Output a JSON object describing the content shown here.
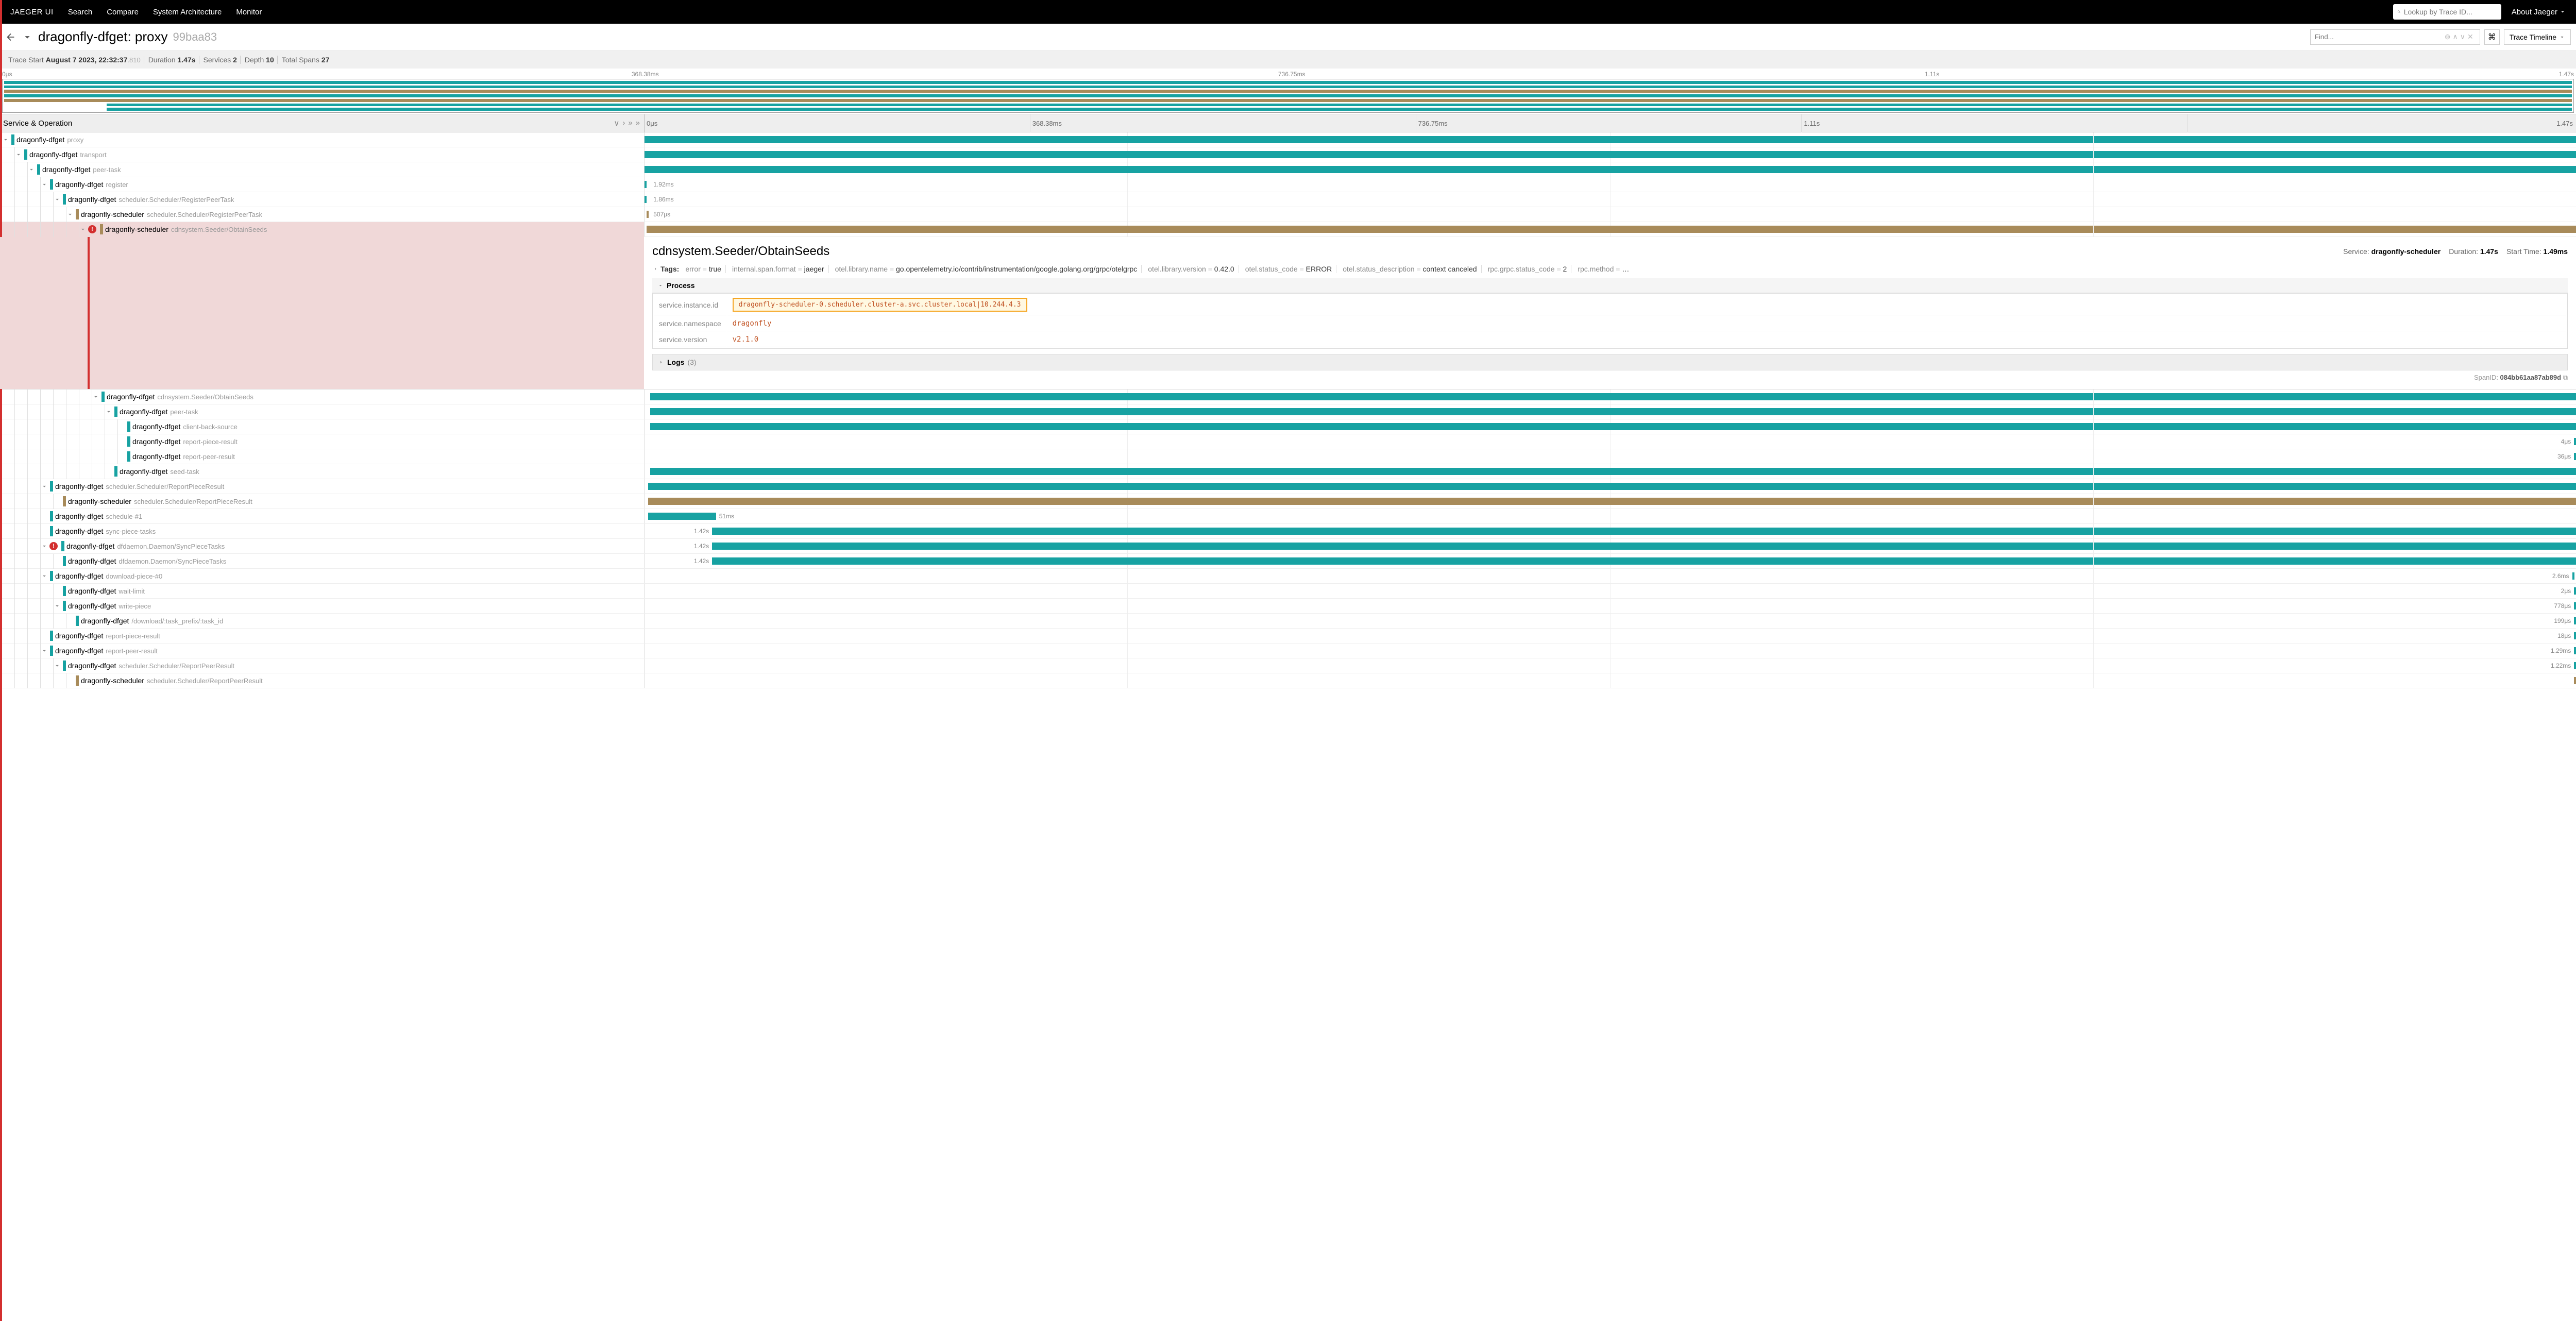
{
  "topbar": {
    "brand": "JAEGER UI",
    "links": [
      "Search",
      "Compare",
      "System Architecture",
      "Monitor"
    ],
    "lookup_placeholder": "Lookup by Trace ID...",
    "about": "About Jaeger"
  },
  "trace": {
    "title_service": "dragonfly-dfget:",
    "title_op": "proxy",
    "trace_id": "99baa83",
    "find_placeholder": "Find...",
    "timeline_btn": "Trace Timeline"
  },
  "meta": {
    "start_label": "Trace Start",
    "start": "August 7 2023, 22:32:37",
    "start_ms": ".810",
    "duration_label": "Duration",
    "duration": "1.47s",
    "services_label": "Services",
    "services": "2",
    "depth_label": "Depth",
    "depth": "10",
    "spans_label": "Total Spans",
    "spans": "27"
  },
  "ticks": [
    "0μs",
    "368.38ms",
    "736.75ms",
    "1.11s",
    "1.47s"
  ],
  "columns_header": "Service & Operation",
  "spans": [
    {
      "depth": 0,
      "chev": true,
      "color": "teal",
      "svc": "dragonfly-dfget",
      "op": "proxy",
      "left": 0,
      "width": 100,
      "err": false
    },
    {
      "depth": 1,
      "chev": true,
      "color": "teal",
      "svc": "dragonfly-dfget",
      "op": "transport",
      "left": 0,
      "width": 100,
      "err": false
    },
    {
      "depth": 2,
      "chev": true,
      "color": "teal",
      "svc": "dragonfly-dfget",
      "op": "peer-task",
      "left": 0,
      "width": 100,
      "err": false
    },
    {
      "depth": 3,
      "chev": true,
      "color": "teal",
      "svc": "dragonfly-dfget",
      "op": "register",
      "left": 0,
      "width": 0.3,
      "dur": "1.92ms",
      "labelpos": "right",
      "err": false
    },
    {
      "depth": 4,
      "chev": true,
      "color": "teal",
      "svc": "dragonfly-dfget",
      "op": "scheduler.Scheduler/RegisterPeerTask",
      "left": 0,
      "width": 0.3,
      "dur": "1.86ms",
      "labelpos": "right",
      "err": false
    },
    {
      "depth": 5,
      "chev": true,
      "color": "brown",
      "svc": "dragonfly-scheduler",
      "op": "scheduler.Scheduler/RegisterPeerTask",
      "left": 0.1,
      "width": 0.2,
      "dur": "507μs",
      "labelpos": "right",
      "err": false
    },
    {
      "depth": 6,
      "chev": true,
      "color": "brown",
      "svc": "dragonfly-scheduler",
      "op": "cdnsystem.Seeder/ObtainSeeds",
      "left": 0.1,
      "width": 99.9,
      "err": true,
      "selected": true,
      "detail": true
    },
    {
      "depth": 7,
      "chev": true,
      "color": "teal",
      "svc": "dragonfly-dfget",
      "op": "cdnsystem.Seeder/ObtainSeeds",
      "left": 0.3,
      "width": 99.7,
      "err": false
    },
    {
      "depth": 8,
      "chev": true,
      "color": "teal",
      "svc": "dragonfly-dfget",
      "op": "peer-task",
      "left": 0.3,
      "width": 99.7,
      "err": false
    },
    {
      "depth": 9,
      "chev": false,
      "color": "teal",
      "svc": "dragonfly-dfget",
      "op": "client-back-source",
      "left": 0.3,
      "width": 99.7,
      "err": false
    },
    {
      "depth": 9,
      "chev": false,
      "color": "teal",
      "svc": "dragonfly-dfget",
      "op": "report-piece-result",
      "left": 99.9,
      "width": 0.1,
      "dur": "4μs",
      "labelpos": "left",
      "err": false
    },
    {
      "depth": 9,
      "chev": false,
      "color": "teal",
      "svc": "dragonfly-dfget",
      "op": "report-peer-result",
      "left": 99.9,
      "width": 0.1,
      "dur": "36μs",
      "labelpos": "left",
      "err": false
    },
    {
      "depth": 8,
      "chev": false,
      "color": "teal",
      "svc": "dragonfly-dfget",
      "op": "seed-task",
      "left": 0.3,
      "width": 99.7,
      "err": false
    },
    {
      "depth": 3,
      "chev": true,
      "color": "teal",
      "svc": "dragonfly-dfget",
      "op": "scheduler.Scheduler/ReportPieceResult",
      "left": 0.2,
      "width": 99.8,
      "err": false
    },
    {
      "depth": 4,
      "chev": false,
      "color": "brown",
      "svc": "dragonfly-scheduler",
      "op": "scheduler.Scheduler/ReportPieceResult",
      "left": 0.2,
      "width": 99.8,
      "err": false
    },
    {
      "depth": 3,
      "chev": false,
      "color": "teal",
      "svc": "dragonfly-dfget",
      "op": "schedule-#1",
      "left": 0.2,
      "width": 3.5,
      "dur": "51ms",
      "labelpos": "right",
      "err": false
    },
    {
      "depth": 3,
      "chev": false,
      "color": "teal",
      "svc": "dragonfly-dfget",
      "op": "sync-piece-tasks",
      "left": 3.5,
      "width": 96.5,
      "dur": "1.42s",
      "labelpos": "leftin",
      "err": false
    },
    {
      "depth": 3,
      "chev": true,
      "color": "teal",
      "svc": "dragonfly-dfget",
      "op": "dfdaemon.Daemon/SyncPieceTasks",
      "left": 3.5,
      "width": 96.5,
      "dur": "1.42s",
      "labelpos": "leftin",
      "err": true
    },
    {
      "depth": 4,
      "chev": false,
      "color": "teal",
      "svc": "dragonfly-dfget",
      "op": "dfdaemon.Daemon/SyncPieceTasks",
      "left": 3.5,
      "width": 96.5,
      "dur": "1.42s",
      "labelpos": "leftin",
      "err": false
    },
    {
      "depth": 3,
      "chev": true,
      "color": "teal",
      "svc": "dragonfly-dfget",
      "op": "download-piece-#0",
      "left": 99.8,
      "width": 0.2,
      "dur": "2.6ms",
      "labelpos": "left",
      "err": false
    },
    {
      "depth": 4,
      "chev": false,
      "color": "teal",
      "svc": "dragonfly-dfget",
      "op": "wait-limit",
      "left": 99.9,
      "width": 0.1,
      "dur": "2μs",
      "labelpos": "left",
      "err": false
    },
    {
      "depth": 4,
      "chev": true,
      "color": "teal",
      "svc": "dragonfly-dfget",
      "op": "write-piece",
      "left": 99.9,
      "width": 0.1,
      "dur": "778μs",
      "labelpos": "left",
      "err": false
    },
    {
      "depth": 5,
      "chev": false,
      "color": "teal",
      "svc": "dragonfly-dfget",
      "op": "/download/:task_prefix/:task_id",
      "left": 99.9,
      "width": 0.1,
      "dur": "199μs",
      "labelpos": "left",
      "err": false
    },
    {
      "depth": 3,
      "chev": false,
      "color": "teal",
      "svc": "dragonfly-dfget",
      "op": "report-piece-result",
      "left": 99.9,
      "width": 0.1,
      "dur": "18μs",
      "labelpos": "left",
      "err": false
    },
    {
      "depth": 3,
      "chev": true,
      "color": "teal",
      "svc": "dragonfly-dfget",
      "op": "report-peer-result",
      "left": 99.9,
      "width": 0.1,
      "dur": "1.29ms",
      "labelpos": "left",
      "err": false
    },
    {
      "depth": 4,
      "chev": true,
      "color": "teal",
      "svc": "dragonfly-dfget",
      "op": "scheduler.Scheduler/ReportPeerResult",
      "left": 99.9,
      "width": 0.1,
      "dur": "1.22ms",
      "labelpos": "left",
      "err": false
    },
    {
      "depth": 5,
      "chev": false,
      "color": "brown",
      "svc": "dragonfly-scheduler",
      "op": "scheduler.Scheduler/ReportPeerResult",
      "left": 99.9,
      "width": 0.1,
      "err": false
    }
  ],
  "detail": {
    "title": "cdnsystem.Seeder/ObtainSeeds",
    "service_label": "Service:",
    "service": "dragonfly-scheduler",
    "duration_label": "Duration:",
    "duration": "1.47s",
    "start_label": "Start Time:",
    "start": "1.49ms",
    "tags_label": "Tags:",
    "tags": [
      {
        "k": "error",
        "v": "true"
      },
      {
        "k": "internal.span.format",
        "v": "jaeger"
      },
      {
        "k": "otel.library.name",
        "v": "go.opentelemetry.io/contrib/instrumentation/google.golang.org/grpc/otelgrpc"
      },
      {
        "k": "otel.library.version",
        "v": "0.42.0"
      },
      {
        "k": "otel.status_code",
        "v": "ERROR"
      },
      {
        "k": "otel.status_description",
        "v": "context canceled"
      },
      {
        "k": "rpc.grpc.status_code",
        "v": "2"
      },
      {
        "k": "rpc.method",
        "v": "…"
      }
    ],
    "process_label": "Process",
    "process": {
      "instance_key": "service.instance.id",
      "instance_val": "dragonfly-scheduler-0.scheduler.cluster-a.svc.cluster.local|10.244.4.3",
      "namespace_key": "service.namespace",
      "namespace_val": "dragonfly",
      "version_key": "service.version",
      "version_val": "v2.1.0"
    },
    "logs_label": "Logs",
    "logs_count": "(3)",
    "spanid_label": "SpanID:",
    "spanid": "084bb61aa87ab89d"
  }
}
